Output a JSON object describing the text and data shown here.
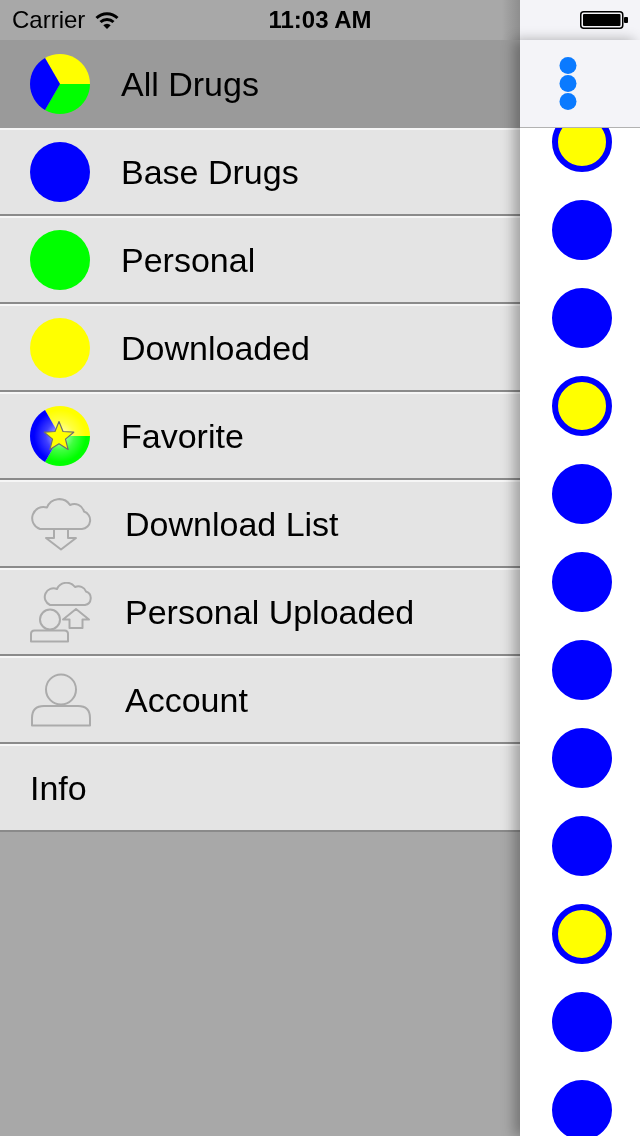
{
  "status_bar": {
    "carrier": "Carrier",
    "time": "11:03 AM"
  },
  "menu": {
    "items": [
      {
        "label": "All Drugs",
        "kind": "all",
        "selected": true
      },
      {
        "label": "Base Drugs",
        "kind": "dot",
        "color": "#0000ff",
        "selected": false
      },
      {
        "label": "Personal",
        "kind": "dot",
        "color": "#00ff00",
        "selected": false
      },
      {
        "label": "Downloaded",
        "kind": "dot",
        "color": "#ffff00",
        "selected": false
      },
      {
        "label": "Favorite",
        "kind": "favorite",
        "selected": false
      },
      {
        "label": "Download List",
        "kind": "download",
        "selected": false
      },
      {
        "label": "Personal Uploaded",
        "kind": "uploaded",
        "selected": false
      },
      {
        "label": "Account",
        "kind": "account",
        "selected": false
      },
      {
        "label": "Info",
        "kind": "text",
        "selected": false
      }
    ]
  },
  "drug_list": {
    "rows": [
      {
        "color": "#ffff00"
      },
      {
        "color": "#0000ff"
      },
      {
        "color": "#0000ff"
      },
      {
        "color": "#ffff00"
      },
      {
        "color": "#0000ff"
      },
      {
        "color": "#0000ff"
      },
      {
        "color": "#0000ff"
      },
      {
        "color": "#0000ff"
      },
      {
        "color": "#0000ff"
      },
      {
        "color": "#ffff00"
      },
      {
        "color": "#0000ff"
      },
      {
        "color": "#0000ff"
      }
    ]
  }
}
